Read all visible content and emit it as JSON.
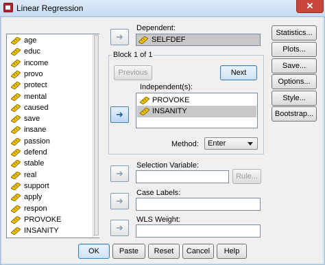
{
  "window": {
    "title": "Linear Regression",
    "close_glyph": "✕"
  },
  "variables": [
    "age",
    "educ",
    "income",
    "provo",
    "protect",
    "mental",
    "caused",
    "save",
    "insane",
    "passion",
    "defend",
    "stable",
    "real",
    "support",
    "apply",
    "respon",
    "PROVOKE",
    "INSANITY"
  ],
  "dependent": {
    "label": "Dependent:",
    "value": "SELFDEF"
  },
  "block": {
    "label": "Block 1 of 1",
    "previous": "Previous",
    "next": "Next"
  },
  "independents": {
    "label": "Independent(s):",
    "items": [
      "PROVOKE",
      "INSANITY"
    ]
  },
  "method": {
    "label": "Method:",
    "value": "Enter"
  },
  "selection": {
    "label": "Selection Variable:",
    "value": "",
    "rule": "Rule..."
  },
  "case_labels": {
    "label": "Case Labels:",
    "value": ""
  },
  "wls": {
    "label": "WLS Weight:",
    "value": ""
  },
  "side_buttons": [
    "Statistics...",
    "Plots...",
    "Save...",
    "Options...",
    "Style...",
    "Bootstrap..."
  ],
  "bottom_buttons": [
    "OK",
    "Paste",
    "Reset",
    "Cancel",
    "Help"
  ],
  "icons": {
    "arrow_right": "arrow-right-icon",
    "arrow_left": "arrow-left-icon",
    "variable": "ruler-icon"
  }
}
